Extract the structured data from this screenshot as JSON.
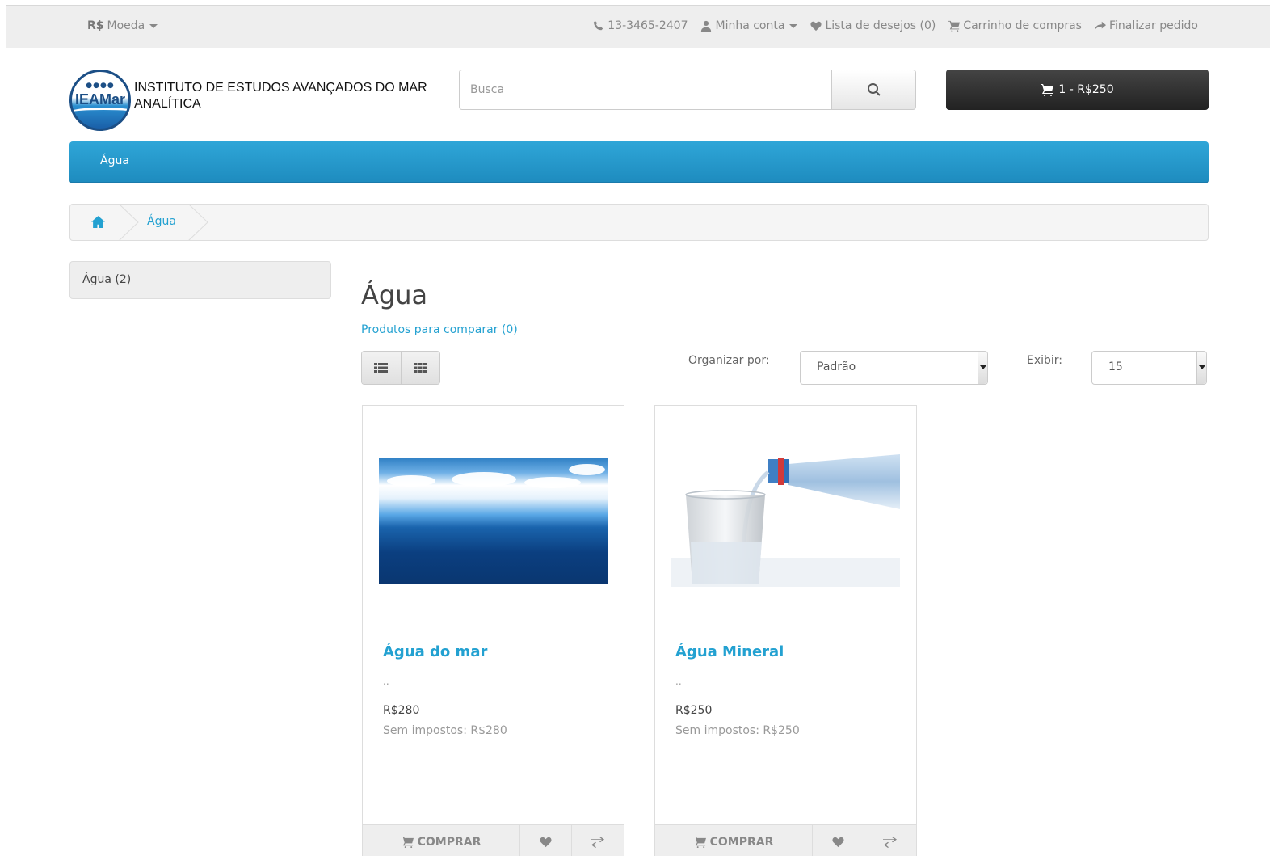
{
  "topbar": {
    "currency_symbol": "R$",
    "currency_label": "Moeda",
    "phone": "13-3465-2407",
    "account": "Minha conta",
    "wishlist": "Lista de desejos (0)",
    "cart_link": "Carrinho de compras",
    "checkout": "Finalizar pedido"
  },
  "header": {
    "logo_mark": "IEAMar",
    "logo_line1": "INSTITUTO DE ESTUDOS AVANÇADOS DO MAR",
    "logo_line2": "ANALÍTICA",
    "search_placeholder": "Busca",
    "cart_button": "1 - R$250"
  },
  "menu": {
    "items": [
      {
        "label": "Água"
      }
    ]
  },
  "breadcrumb": {
    "items": [
      {
        "label": "Água"
      }
    ]
  },
  "sidebar": {
    "categories": [
      {
        "label": "Água (2)"
      }
    ]
  },
  "main": {
    "title": "Água",
    "compare": "Produtos para comparar (0)",
    "sort_label": "Organizar por:",
    "sort_value": "Padrão",
    "limit_label": "Exibir:",
    "limit_value": "15"
  },
  "products": [
    {
      "name": "Água do mar",
      "description": "..",
      "price": "R$280",
      "tax": "Sem impostos: R$280",
      "buy": "COMPRAR"
    },
    {
      "name": "Água Mineral",
      "description": "..",
      "price": "R$250",
      "tax": "Sem impostos: R$250",
      "buy": "COMPRAR"
    }
  ],
  "colors": {
    "accent": "#23a1d1",
    "menu": "#229ace",
    "cart_button": "#333333"
  }
}
